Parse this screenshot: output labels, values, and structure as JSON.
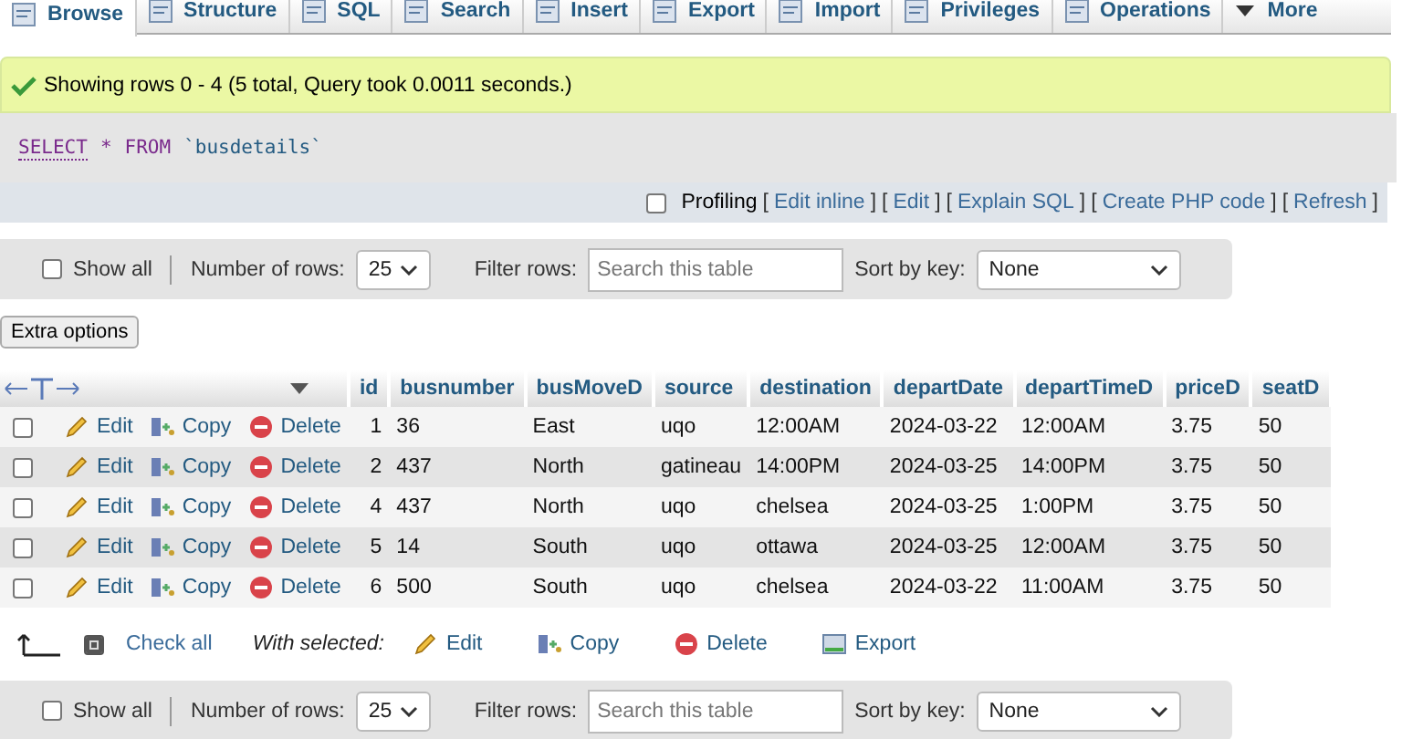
{
  "tabs": [
    {
      "label": "Browse",
      "selected": true
    },
    {
      "label": "Structure",
      "selected": false
    },
    {
      "label": "SQL",
      "selected": false
    },
    {
      "label": "Search",
      "selected": false
    },
    {
      "label": "Insert",
      "selected": false
    },
    {
      "label": "Export",
      "selected": false
    },
    {
      "label": "Import",
      "selected": false
    },
    {
      "label": "Privileges",
      "selected": false
    },
    {
      "label": "Operations",
      "selected": false
    },
    {
      "label": "More",
      "selected": false
    }
  ],
  "success_message": "Showing rows 0 - 4 (5 total, Query took 0.0011 seconds.)",
  "query": {
    "keyword1": "SELECT",
    "star": "*",
    "keyword2": "FROM",
    "table": "`busdetails`"
  },
  "profiling": {
    "label": "Profiling",
    "checked": false,
    "links": [
      {
        "open": "[",
        "label": "Edit inline",
        "close": "]"
      },
      {
        "open": "[",
        "label": "Edit",
        "close": "]"
      },
      {
        "open": "[",
        "label": "Explain SQL",
        "close": "]"
      },
      {
        "open": "[",
        "label": "Create PHP code",
        "close": "]"
      },
      {
        "open": "[",
        "label": "Refresh",
        "close": "]"
      }
    ]
  },
  "nav_top": {
    "show_all": "Show all",
    "show_all_checked": false,
    "rows_label": "Number of rows:",
    "rows_value": "25",
    "filter_label": "Filter rows:",
    "filter_placeholder": "Search this table",
    "sort_label": "Sort by key:",
    "sort_value": "None"
  },
  "extra_options": "Extra options",
  "table": {
    "columns": [
      "id",
      "busnumber",
      "busMoveD",
      "source",
      "destination",
      "departDate",
      "departTimeD",
      "priceD",
      "seatD"
    ],
    "rows": [
      {
        "checked": false,
        "actions": [
          "Edit",
          "Copy",
          "Delete"
        ],
        "cells": [
          "1",
          "36",
          "East",
          "uqo",
          "12:00AM",
          "2024-03-22",
          "12:00AM",
          "3.75",
          "50"
        ]
      },
      {
        "checked": false,
        "actions": [
          "Edit",
          "Copy",
          "Delete"
        ],
        "cells": [
          "2",
          "437",
          "North",
          "gatineau",
          "14:00PM",
          "2024-03-25",
          "14:00PM",
          "3.75",
          "50"
        ]
      },
      {
        "checked": false,
        "actions": [
          "Edit",
          "Copy",
          "Delete"
        ],
        "cells": [
          "4",
          "437",
          "North",
          "uqo",
          "chelsea",
          "2024-03-25",
          "1:00PM",
          "3.75",
          "50"
        ]
      },
      {
        "checked": false,
        "actions": [
          "Edit",
          "Copy",
          "Delete"
        ],
        "cells": [
          "5",
          "14",
          "South",
          "uqo",
          "ottawa",
          "2024-03-25",
          "12:00AM",
          "3.75",
          "50"
        ]
      },
      {
        "checked": false,
        "actions": [
          "Edit",
          "Copy",
          "Delete"
        ],
        "cells": [
          "6",
          "500",
          "South",
          "uqo",
          "chelsea",
          "2024-03-22",
          "11:00AM",
          "3.75",
          "50"
        ]
      }
    ]
  },
  "bulk": {
    "check_all": "Check all",
    "check_all_checked": true,
    "with_selected": "With selected:",
    "actions": [
      "Edit",
      "Copy",
      "Delete",
      "Export"
    ]
  },
  "nav_bottom": {
    "show_all": "Show all",
    "show_all_checked": false,
    "rows_label": "Number of rows:",
    "rows_value": "25",
    "filter_label": "Filter rows:",
    "filter_placeholder": "Search this table",
    "sort_label": "Sort by key:",
    "sort_value": "None"
  }
}
